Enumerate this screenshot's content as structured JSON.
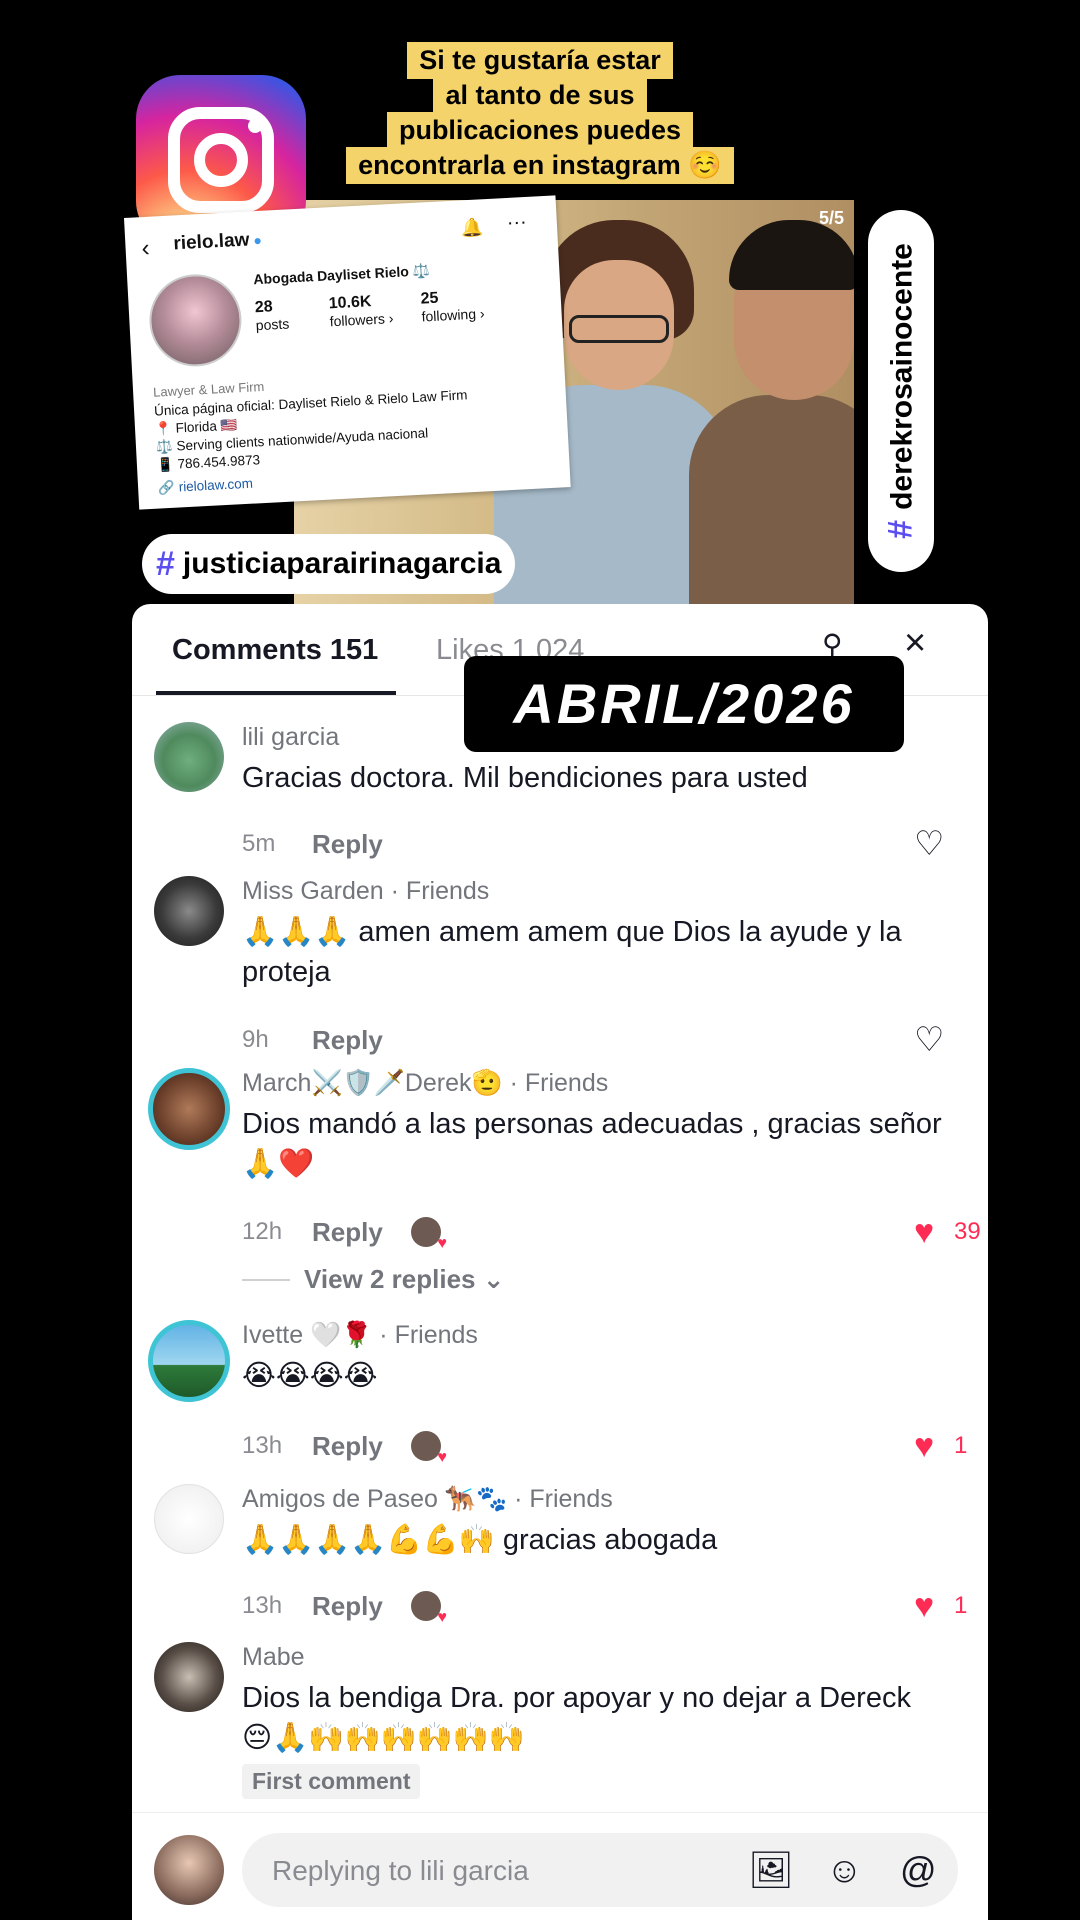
{
  "overlay": {
    "caption_lines": [
      "Si te gustaría estar",
      "al tanto de sus",
      "publicaciones puedes",
      "encontrarla en instagram ☺️"
    ],
    "video_counter": "5/5",
    "hashtag_left": "justiciaparairinagarcia",
    "hashtag_right": "derekrosainocente",
    "hash_symbol": "#",
    "sticker": "ABRIL/2026"
  },
  "ig_card": {
    "handle": "rielo.law",
    "name": "Abogada Dayliset Rielo ⚖️",
    "stats": [
      {
        "value": "28",
        "label": "posts"
      },
      {
        "value": "10.6K",
        "label": "followers ›"
      },
      {
        "value": "25",
        "label": "following ›"
      }
    ],
    "category": "Lawyer & Law Firm",
    "bio_lines": [
      "Única página oficial: Dayliset Rielo & Rielo Law Firm",
      "📍 Florida 🇺🇸",
      "⚖️ Serving clients nationwide/Ayuda nacional",
      "📱 786.454.9873"
    ],
    "link": "rielolaw.com"
  },
  "tabs": {
    "comments": "Comments 151",
    "likes": "Likes 1,024"
  },
  "comments": [
    {
      "author": "lili garcia",
      "text": "Gracias doctora. Mil bendiciones para usted",
      "time": "5m",
      "reply": "Reply",
      "likes": ""
    },
    {
      "author": "Miss Garden · Friends",
      "text": "🙏🙏🙏 amen amem amem que Dios la ayude y la proteja",
      "time": "9h",
      "reply": "Reply",
      "likes": ""
    },
    {
      "author": "March⚔️🛡️🗡️Derek🫡 · Friends",
      "text": "Dios mandó a las personas adecuadas , gracias señor🙏❤️",
      "time": "12h",
      "reply": "Reply",
      "likes": "39"
    },
    {
      "author": "Ivette 🤍🌹 · Friends",
      "text": "😭😭😭😭",
      "time": "13h",
      "reply": "Reply",
      "likes": "1"
    },
    {
      "author": "Amigos de Paseo 🐕‍🦺🐾 · Friends",
      "text": "🙏🙏🙏🙏💪💪🙌 gracias abogada",
      "time": "13h",
      "reply": "Reply",
      "likes": "1"
    },
    {
      "author": "Mabe",
      "text": "Dios la bendiga Dra. por apoyar y no dejar a Dereck 😔🙏🙌🙌🙌🙌🙌🙌",
      "first_comment": "First comment"
    }
  ],
  "view_replies": "View 2 replies ⌄",
  "input": {
    "placeholder": "Replying to lili garcia"
  },
  "colors": {
    "like_red": "#fe2c55",
    "caption_bg": "#f3d36a",
    "hashtag_purple": "#5b4ef0"
  }
}
